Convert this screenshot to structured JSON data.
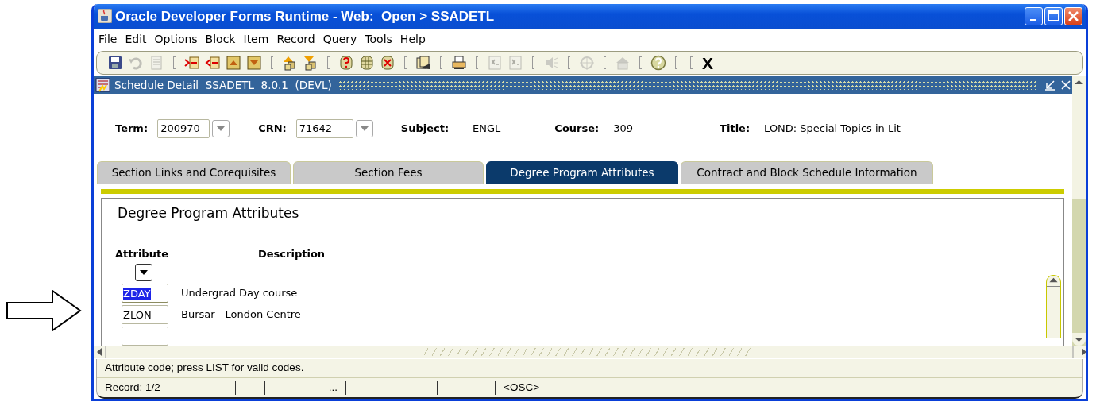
{
  "window": {
    "title": "Oracle Developer Forms Runtime - Web:  Open > SSADETL"
  },
  "menu": [
    "File",
    "Edit",
    "Options",
    "Block",
    "Item",
    "Record",
    "Query",
    "Tools",
    "Help"
  ],
  "toolbar": [
    {
      "kind": "save",
      "disabled": false
    },
    {
      "kind": "undo",
      "disabled": true
    },
    {
      "kind": "page",
      "disabled": true
    },
    {
      "kind": "separator"
    },
    {
      "kind": "insert",
      "disabled": false
    },
    {
      "kind": "remove",
      "disabled": false
    },
    {
      "kind": "prevblock",
      "disabled": false
    },
    {
      "kind": "nextblock",
      "disabled": false
    },
    {
      "kind": "separator"
    },
    {
      "kind": "enterquery",
      "disabled": false
    },
    {
      "kind": "executequery",
      "disabled": false
    },
    {
      "kind": "separator"
    },
    {
      "kind": "dbquestion",
      "disabled": false
    },
    {
      "kind": "db",
      "disabled": false
    },
    {
      "kind": "dbdelete",
      "disabled": false
    },
    {
      "kind": "separator"
    },
    {
      "kind": "doc",
      "disabled": false
    },
    {
      "kind": "separator"
    },
    {
      "kind": "print",
      "disabled": false
    },
    {
      "kind": "separator"
    },
    {
      "kind": "sheet",
      "disabled": true
    },
    {
      "kind": "sheet",
      "disabled": true
    },
    {
      "kind": "separator"
    },
    {
      "kind": "speaker",
      "disabled": true
    },
    {
      "kind": "separator"
    },
    {
      "kind": "target",
      "disabled": true
    },
    {
      "kind": "separator"
    },
    {
      "kind": "house",
      "disabled": true
    },
    {
      "kind": "separator"
    },
    {
      "kind": "help",
      "disabled": false
    },
    {
      "kind": "separator"
    },
    {
      "kind": "separator"
    },
    {
      "kind": "text",
      "label": "X",
      "disabled": false
    }
  ],
  "form": {
    "title": "Schedule Detail  SSADETL  8.0.1  (DEVL)"
  },
  "key_block": [
    {
      "kind": "lov",
      "label": "Term:",
      "value": "200970"
    },
    {
      "kind": "lov",
      "label": "CRN:",
      "value": "71642"
    },
    {
      "kind": "display",
      "label": "Subject:",
      "value": "ENGL"
    },
    {
      "kind": "display",
      "label": "Course:",
      "value": "309"
    },
    {
      "kind": "display",
      "label": "Title:",
      "value": "LOND: Special Topics in Lit"
    }
  ],
  "tabs": [
    {
      "label": "Section Links and Corequisites",
      "selected": false
    },
    {
      "label": "Section Fees",
      "selected": false
    },
    {
      "label": "Degree Program Attributes",
      "selected": true
    },
    {
      "label": "Contract and Block Schedule Information",
      "selected": false
    }
  ],
  "panel": {
    "heading": "Degree Program Attributes",
    "columns": [
      "Attribute",
      "Description"
    ],
    "rows": [
      {
        "kind": "entry",
        "attribute": "ZDAY",
        "description": "Undergrad Day course",
        "selected": true
      },
      {
        "kind": "entry",
        "attribute": "ZLON",
        "description": "Bursar - London Centre",
        "selected": false
      },
      {
        "kind": "blank",
        "selected": false
      }
    ]
  },
  "status_bar": {
    "message": "Attribute code; press LIST for valid codes.",
    "segments": [
      {
        "kind": "text",
        "text": "Record: 1/2"
      },
      {
        "kind": "blank"
      },
      {
        "kind": "text",
        "text": "..."
      },
      {
        "kind": "blank"
      },
      {
        "kind": "blank"
      },
      {
        "kind": "text",
        "text": "<OSC>"
      }
    ]
  }
}
